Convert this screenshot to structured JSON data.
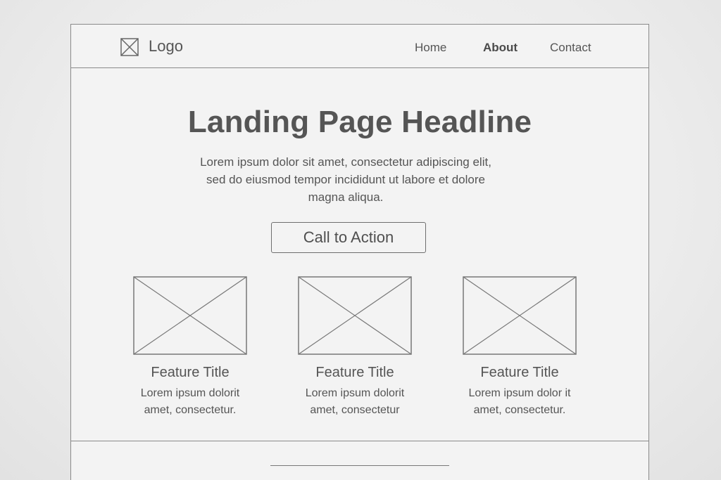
{
  "nav": {
    "logo_label": "Logo",
    "items": [
      {
        "label": "Home",
        "active": false
      },
      {
        "label": "About",
        "active": true
      },
      {
        "label": "Contact",
        "active": false
      }
    ]
  },
  "hero": {
    "headline": "Landing Page Headline",
    "intro_lines": [
      "Lorem ipsum dolor sit amet, consectetur adipiscing elit,",
      "sed do eiusmod tempor incididunt ut labore et dolore",
      "magna aliqua."
    ],
    "cta_label": "Call to Action"
  },
  "features": [
    {
      "title": "Feature Title",
      "text_lines": [
        "Lorem ipsum dolorit",
        "amet, consectetur."
      ]
    },
    {
      "title": "Feature Title",
      "text_lines": [
        "Lorem ipsum dolorit",
        "amet, consectetur"
      ]
    },
    {
      "title": "Feature Title",
      "text_lines": [
        "Lorem ipsum dolor it",
        "amet, consectetur."
      ]
    }
  ],
  "icons": {
    "logo": "image-placeholder-icon",
    "feature_image": "image-placeholder-icon"
  },
  "colors": {
    "line": "#8a8a8a",
    "text": "#555555",
    "background": "#f3f3f3"
  }
}
